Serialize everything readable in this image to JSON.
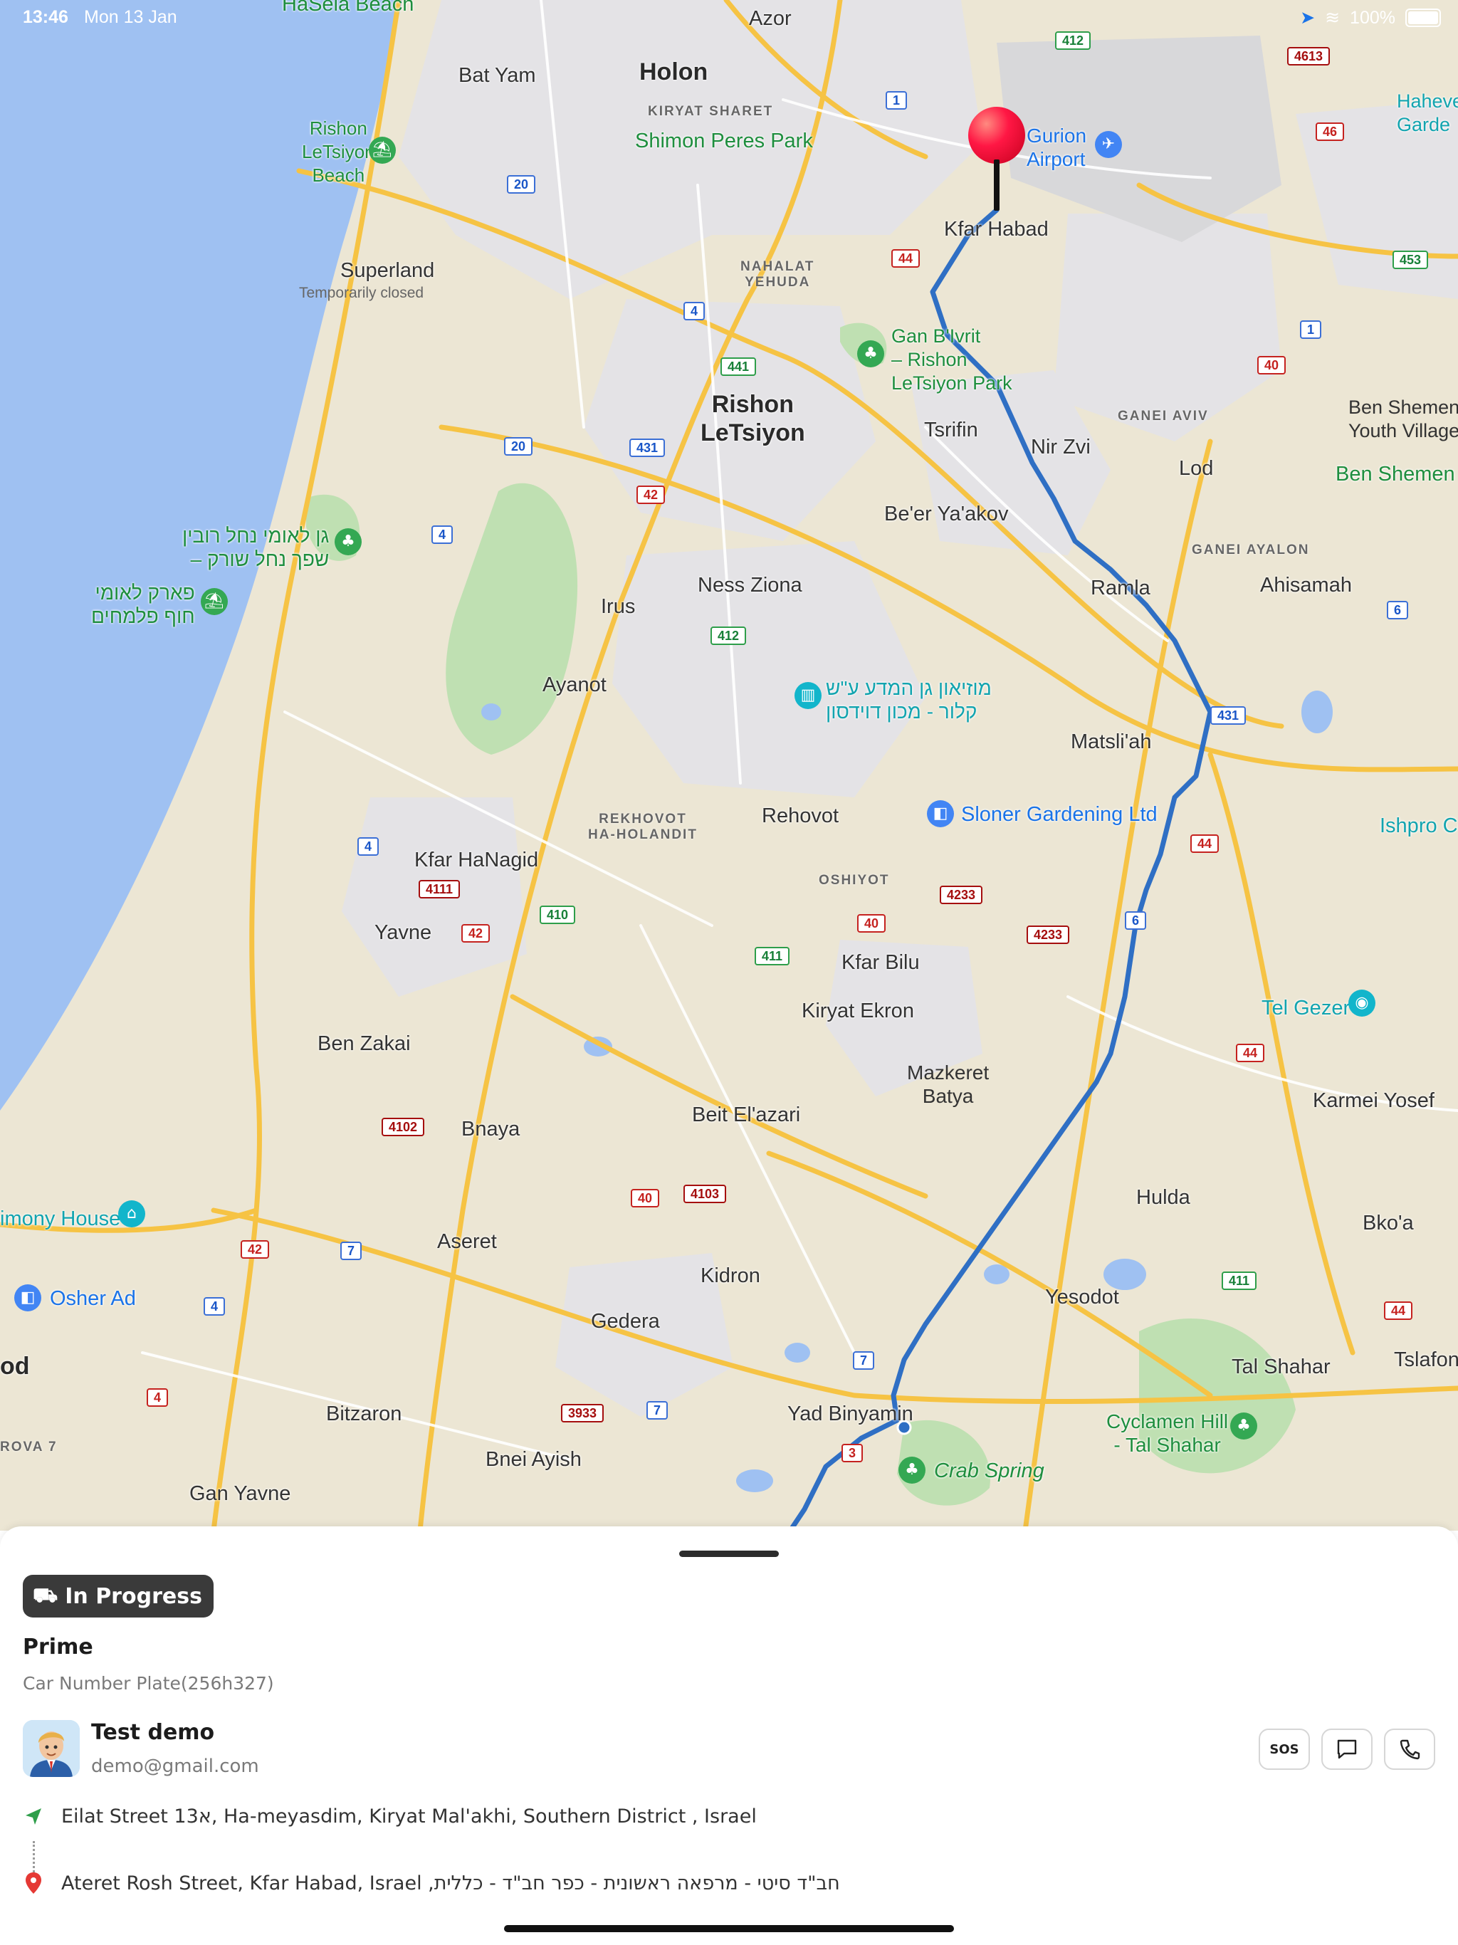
{
  "status_bar": {
    "time": "13:46",
    "date": "Mon 13 Jan",
    "battery": "100%"
  },
  "map": {
    "labels": {
      "hasela": "HaSela Beach",
      "azor": "Azor",
      "holon": "Holon",
      "bat_yam": "Bat Yam",
      "kiryat_sharet": "KIRYAT SHARET",
      "shimon_peres": "Shimon Peres Park",
      "rishon_beach": "Rishon\nLeTsiyon\nBeach",
      "superland": "Superland",
      "temp_closed": "Temporarily closed",
      "nahalat": "NAHALAT\nYEHUDA",
      "ben_gurion": "Gurion\nAirport",
      "kfar_habad_top": "Kfar Habad",
      "haheve": "Haheve\nGarde",
      "gan_bivrit": "Gan B'Ivrit\n– Rishon\nLeTsiyon Park",
      "rishon": "Rishon\nLeTsiyon",
      "tsrifin": "Tsrifin",
      "nir_zvi": "Nir Zvi",
      "ganei_aviv": "GANEI AVIV",
      "ben_shemen_yv": "Ben Shemen\nYouth Village",
      "ben_shemen_f": "Ben Shemen F",
      "lod": "Lod",
      "beer_yaakov": "Be'er Ya'akov",
      "ganei_ayalon": "GANEI AYALON",
      "nahal_rubin": "גן לאומי נחל רובין\n– שפך נחל שורק",
      "park_palmahim": "פארק לאומי\nחוף פלמחים",
      "ness_ziona": "Ness Ziona",
      "irus": "Irus",
      "ramla": "Ramla",
      "ahisamah": "Ahisamah",
      "ayanot": "Ayanot",
      "museum": "מוזיאון גן המדע ע\"ש\nקלור - מכון דוידסון",
      "matsliah": "Matsli'ah",
      "sloner": "Sloner Gardening Ltd",
      "ishpro": "Ishpro Ce",
      "rekhovot_ha": "REKHOVOT\nHA-HOLANDIT",
      "rehovot": "Rehovot",
      "kfar_hanagid": "Kfar HaNagid",
      "oshiyot": "OSHIYOT",
      "yavne": "Yavne",
      "kfar_bilu": "Kfar Bilu",
      "kiryat_ekron": "Kiryat Ekron",
      "tel_gezer": "Tel Gezer",
      "ben_zakai": "Ben Zakai",
      "mazkeret": "Mazkeret\nBatya",
      "karmei_yosef": "Karmei Yosef",
      "beit_elazari": "Beit El'azari",
      "bnaya": "Bnaya",
      "hulda": "Hulda",
      "imony": "imony House",
      "bkoa": "Bko'a",
      "aseret": "Aseret",
      "kidron": "Kidron",
      "osher": "Osher Ad",
      "yesodot": "Yesodot",
      "gedera": "Gedera",
      "tal_shahar": "Tal Shahar",
      "tslafon": "Tslafon",
      "od": "od",
      "bitzaron": "Bitzaron",
      "yad_binyamin": "Yad Binyamin",
      "cyclamen": "Cyclamen Hill\n- Tal Shahar",
      "rova": "ROVA 7",
      "bnei_ayish": "Bnei Ayish",
      "crab_spring": "Crab Spring",
      "gan_yavne": "Gan Yavne"
    },
    "shields": [
      "412",
      "4613",
      "1",
      "46",
      "20",
      "44",
      "453",
      "4",
      "1",
      "441",
      "40",
      "20",
      "431",
      "42",
      "4",
      "6",
      "412",
      "431",
      "4",
      "44",
      "4111",
      "4233",
      "42",
      "410",
      "40",
      "4233",
      "411",
      "44",
      "4102",
      "40",
      "4103",
      "42",
      "7",
      "411",
      "4",
      "7",
      "44",
      "4",
      "3933",
      "7",
      "3",
      "6"
    ]
  },
  "trip": {
    "status": "In Progress",
    "status_icon": "car-icon",
    "service": "Prime",
    "plate": "Car Number Plate(256h327)",
    "user": {
      "name": "Test demo",
      "email": "demo@gmail.com"
    },
    "actions": {
      "sos": "SOS"
    },
    "pickup": "Eilat Street 13א, Ha-meyasdim, Kiryat Mal'akhi, Southern District , Israel",
    "dropoff": "חב\"ד סיטי - מרפאה ראשונית - כפר חב\"ד - כללית, Ateret Rosh Street, Kfar Habad, Israel"
  },
  "colors": {
    "route": "#2f6fc4",
    "pin": "#ff1744",
    "sea": "#9fc1f2",
    "land": "#ece6d4"
  }
}
